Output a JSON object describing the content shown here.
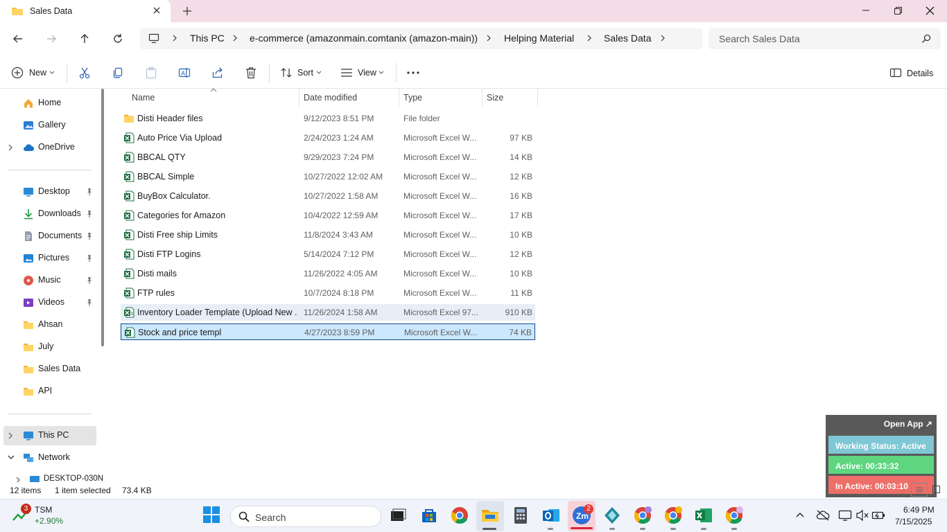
{
  "window": {
    "tab_title": "Sales Data",
    "new_tab_icon": "plus-icon",
    "controls": [
      "minimize-icon",
      "restore-icon",
      "close-icon"
    ]
  },
  "address": {
    "crumbs": [
      "This PC",
      "e-commerce (amazonmain.comtanix (amazon-main))",
      "Helping Material",
      "Sales Data"
    ],
    "search_placeholder": "Search Sales Data"
  },
  "toolbar": {
    "new_label": "New",
    "sort_label": "Sort",
    "view_label": "View",
    "details_label": "Details",
    "icons": [
      "cut-icon",
      "copy-icon",
      "paste-icon",
      "rename-icon",
      "share-icon",
      "delete-icon",
      "more-icon"
    ]
  },
  "sidebar": {
    "top": [
      {
        "label": "Home",
        "icon": "home-icon"
      },
      {
        "label": "Gallery",
        "icon": "gallery-icon"
      },
      {
        "label": "OneDrive",
        "icon": "cloud-icon"
      }
    ],
    "quick": [
      {
        "label": "Desktop",
        "icon": "desktop-icon",
        "pinned": true
      },
      {
        "label": "Downloads",
        "icon": "download-icon",
        "pinned": true
      },
      {
        "label": "Documents",
        "icon": "documents-icon",
        "pinned": true
      },
      {
        "label": "Pictures",
        "icon": "pictures-icon",
        "pinned": true
      },
      {
        "label": "Music",
        "icon": "music-icon",
        "pinned": true
      },
      {
        "label": "Videos",
        "icon": "videos-icon",
        "pinned": true
      },
      {
        "label": "Ahsan",
        "icon": "folder-icon",
        "pinned": false
      },
      {
        "label": "July",
        "icon": "folder-icon",
        "pinned": false
      },
      {
        "label": "Sales Data",
        "icon": "folder-icon",
        "pinned": false
      },
      {
        "label": "API",
        "icon": "folder-icon",
        "pinned": false
      }
    ],
    "bottom": [
      {
        "label": "This PC",
        "icon": "pc-icon"
      },
      {
        "label": "Network",
        "icon": "network-icon"
      },
      {
        "label": "DESKTOP-030N",
        "icon": "computer-icon"
      }
    ]
  },
  "columns": {
    "name": "Name",
    "date": "Date modified",
    "type": "Type",
    "size": "Size"
  },
  "files": [
    {
      "name": "Disti Header files",
      "date": "9/12/2023 8:51 PM",
      "type": "File folder",
      "size": "",
      "kind": "folder"
    },
    {
      "name": "Auto Price Via Upload",
      "date": "2/24/2023 1:24 AM",
      "type": "Microsoft Excel W...",
      "size": "97 KB",
      "kind": "excel"
    },
    {
      "name": "BBCAL QTY",
      "date": "9/29/2023 7:24 PM",
      "type": "Microsoft Excel W...",
      "size": "14 KB",
      "kind": "excel"
    },
    {
      "name": "BBCAL Simple",
      "date": "10/27/2022 12:02 AM",
      "type": "Microsoft Excel W...",
      "size": "12 KB",
      "kind": "excel"
    },
    {
      "name": "BuyBox Calculator.",
      "date": "10/27/2022 1:58 AM",
      "type": "Microsoft Excel W...",
      "size": "16 KB",
      "kind": "excel"
    },
    {
      "name": "Categories for Amazon",
      "date": "10/4/2022 12:59 AM",
      "type": "Microsoft Excel W...",
      "size": "17 KB",
      "kind": "excel"
    },
    {
      "name": "Disti Free ship Limits",
      "date": "11/8/2024 3:43 AM",
      "type": "Microsoft Excel W...",
      "size": "10 KB",
      "kind": "excel"
    },
    {
      "name": "Disti FTP Logins",
      "date": "5/14/2024 7:12 PM",
      "type": "Microsoft Excel W...",
      "size": "12 KB",
      "kind": "excel"
    },
    {
      "name": "Disti mails",
      "date": "11/26/2022 4:05 AM",
      "type": "Microsoft Excel W...",
      "size": "10 KB",
      "kind": "excel"
    },
    {
      "name": "FTP rules",
      "date": "10/7/2024 8:18 PM",
      "type": "Microsoft Excel W...",
      "size": "11 KB",
      "kind": "excel"
    },
    {
      "name": "Inventory Loader Template (Upload New ...",
      "date": "11/26/2024 1:58 AM",
      "type": "Microsoft Excel 97...",
      "size": "910 KB",
      "kind": "excel97"
    },
    {
      "name": "Stock and price templ",
      "date": "4/27/2023 8:59 PM",
      "type": "Microsoft Excel W...",
      "size": "74 KB",
      "kind": "excel"
    }
  ],
  "status": {
    "count": "12 items",
    "selected": "1 item selected",
    "size": "73.4 KB"
  },
  "widget": {
    "open_label": "Open App ↗",
    "working": "Working Status: Active",
    "active": "Active: 00:33:32",
    "inactive": "In Active: 00:03:10",
    "colors": {
      "working": "#7fc7d4",
      "active": "#5dd67f",
      "inactive": "#ec6f68"
    }
  },
  "taskbar": {
    "stock_badge": "3",
    "stock_symbol": "TSM",
    "stock_change": "+2.90%",
    "search_label": "Search",
    "zoom_badge": "2",
    "time": "6:49 PM",
    "date": "7/15/2025",
    "apps": [
      "task-view-icon",
      "store-icon",
      "chrome-icon",
      "file-explorer-icon",
      "calculator-icon",
      "outlook-icon",
      "zoom-icon",
      "app-icon",
      "chrome-profile-icon",
      "chrome-profile-2-icon",
      "excel-icon",
      "chrome-profile-3-icon"
    ]
  }
}
